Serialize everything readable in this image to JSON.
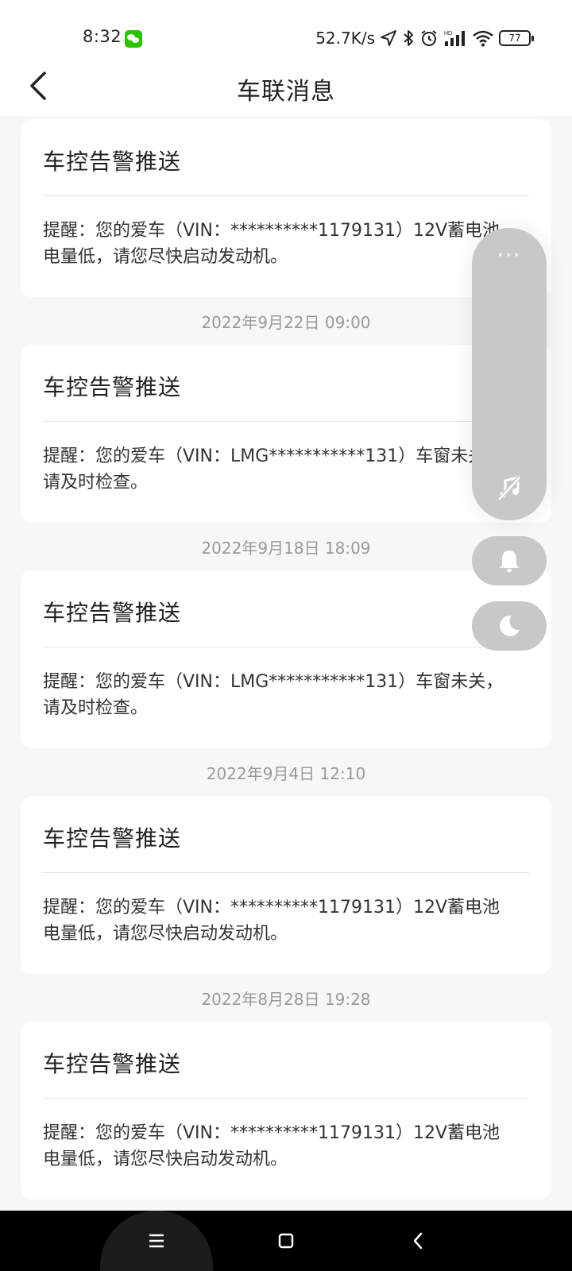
{
  "status_bar": {
    "time": "8:32",
    "network_speed": "52.7K/s",
    "battery": "77"
  },
  "header": {
    "title": "车联消息"
  },
  "messages": [
    {
      "title": "车控告警推送",
      "body": "提醒：您的爱车（VIN：**********1179131）12V蓄电池\n电量低，请您尽快启动发动机。",
      "timestamp": ""
    },
    {
      "title": "车控告警推送",
      "body": "提醒：您的爱车（VIN：LMG***********131）车窗未关，\n请及时检查。",
      "timestamp": "2022年9月22日 09:00"
    },
    {
      "title": "车控告警推送",
      "body": "提醒：您的爱车（VIN：LMG***********131）车窗未关，\n请及时检查。",
      "timestamp": "2022年9月18日 18:09"
    },
    {
      "title": "车控告警推送",
      "body": "提醒：您的爱车（VIN：**********1179131）12V蓄电池\n电量低，请您尽快启动发动机。",
      "timestamp": "2022年9月4日 12:10"
    },
    {
      "title": "车控告警推送",
      "body": "提醒：您的爱车（VIN：**********1179131）12V蓄电池\n电量低，请您尽快启动发动机。",
      "timestamp": "2022年8月28日 19:28"
    }
  ],
  "floating_panel": {
    "more": "···",
    "icons": [
      "music-off-icon",
      "bell-icon",
      "moon-icon"
    ]
  },
  "nav_bar": {
    "icons": [
      "menu-icon",
      "home-icon",
      "back-icon"
    ]
  },
  "colors": {
    "background": "#f6f7f7",
    "card": "#ffffff",
    "timestamp": "#999999",
    "float_panel": "#c8c8c8",
    "wechat": "#2dc100"
  }
}
